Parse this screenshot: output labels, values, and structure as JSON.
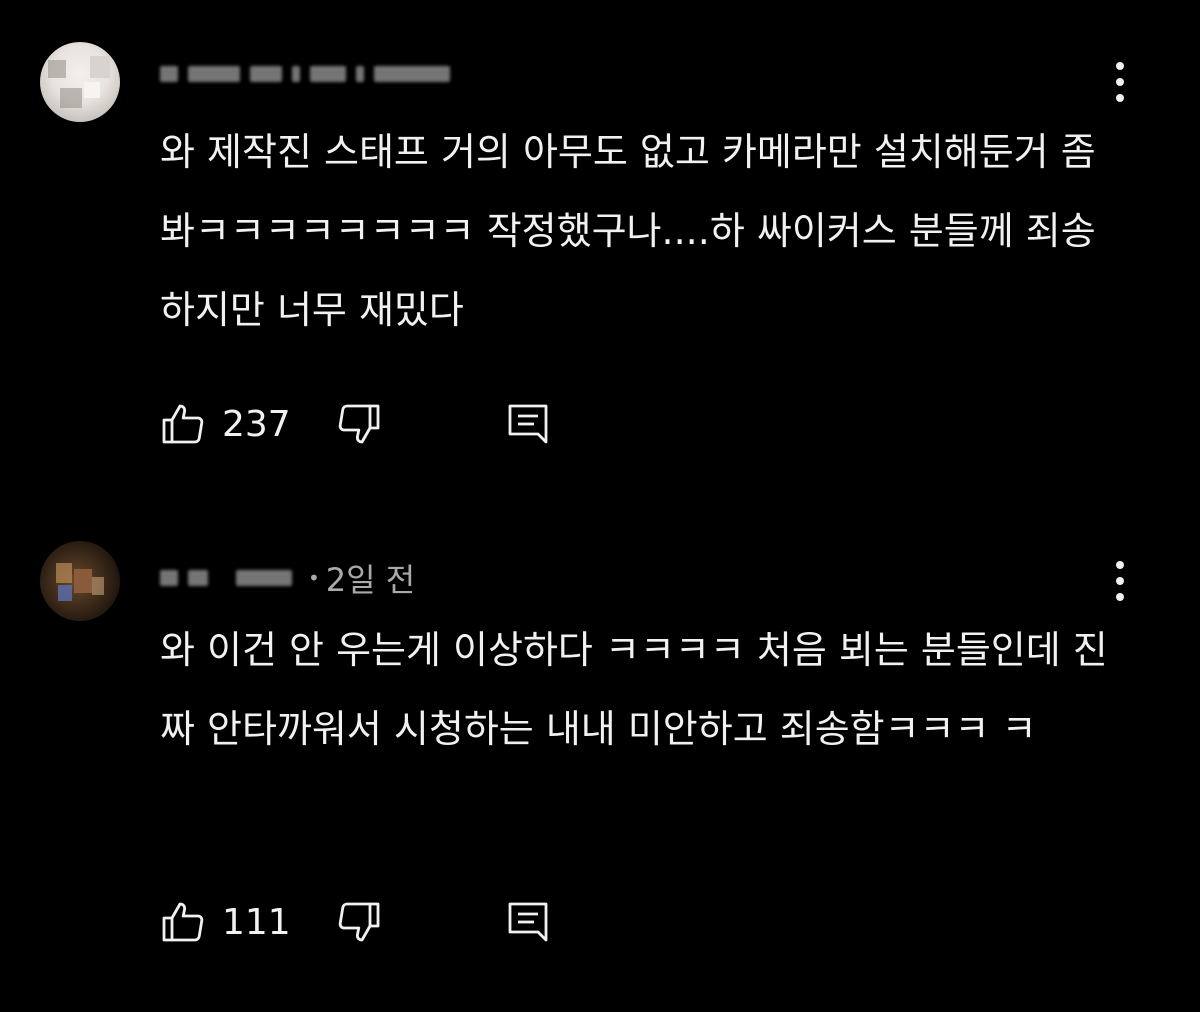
{
  "comments": [
    {
      "author": "",
      "time": "",
      "text": "와 제작진 스태프 거의 아무도 없고 카메라만 설치해둔거 좀 봐ㅋㅋㅋㅋㅋㅋㅋㅋ 작정했구나....하 싸이커스 분들께 죄송하지만 너무 재밌다",
      "likes": "237",
      "icons": {
        "like": "thumbs-up-icon",
        "dislike": "thumbs-down-icon",
        "reply": "reply-icon",
        "more": "more-vertical-icon"
      }
    },
    {
      "author": "",
      "time": "2일 전",
      "text": "와 이건 안 우는게 이상하다 ㅋㅋㅋㅋ 처음 뵈는 분들인데 진짜 안타까워서 시청하는 내내 미안하고 죄송함ㅋㅋㅋ ㅋ",
      "likes": "111",
      "icons": {
        "like": "thumbs-up-icon",
        "dislike": "thumbs-down-icon",
        "reply": "reply-icon",
        "more": "more-vertical-icon"
      }
    }
  ],
  "colors": {
    "background": "#000000",
    "text": "#f1f1f1",
    "secondary": "#aaaaaa"
  }
}
